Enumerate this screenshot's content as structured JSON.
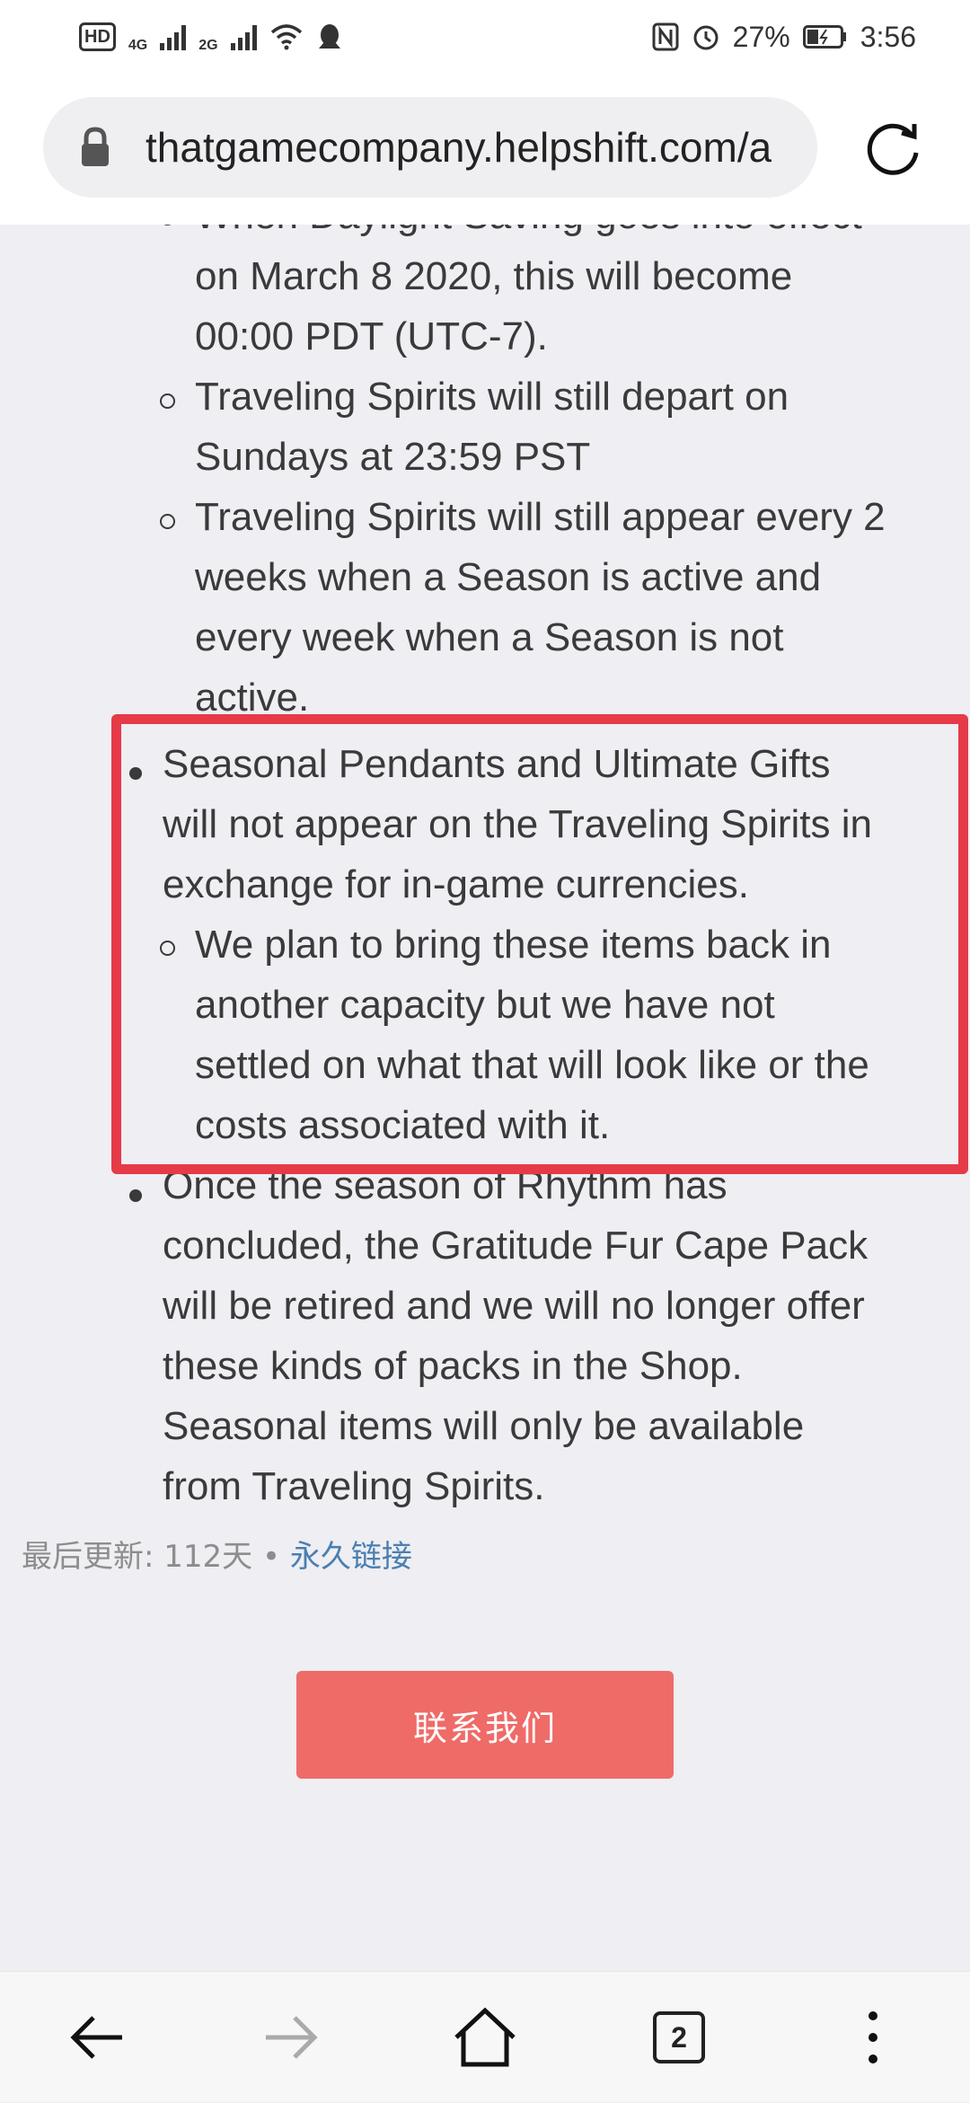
{
  "status_bar": {
    "hd": "HD",
    "net1": "4G",
    "net2": "2G",
    "battery": "27%",
    "time": "3:56",
    "icons": [
      "nfc-icon",
      "alarm-icon",
      "battery-icon",
      "wifi-icon",
      "notification-icon"
    ]
  },
  "browser": {
    "url": "thatgamecompany.helpshift.com/a",
    "tab_count": "2"
  },
  "article": {
    "lines": [
      "When Daylight Saving goes into effect",
      "on March 8 2020, this will become",
      "00:00 PDT (UTC-7).",
      "Traveling Spirits will still depart on",
      "Sundays at 23:59 PST",
      "Traveling Spirits will still appear every 2",
      "weeks when a Season is active and",
      "every week when a Season is not",
      "active.",
      "Seasonal Pendants and Ultimate Gifts",
      "will not appear on the Traveling Spirits in",
      "exchange for in-game currencies.",
      "We plan to bring these items back in",
      "another capacity but we have not",
      "settled on what that will look like or the",
      "costs associated with it.",
      "Once the season of Rhythm has",
      "concluded, the Gratitude Fur Cape Pack",
      "will be retired and we will no longer offer",
      "these kinds of packs in the Shop.",
      "Seasonal items will only be available",
      "from Traveling Spirits."
    ]
  },
  "footer": {
    "updated": "最后更新: 112天 • ",
    "permalink": "永久链接",
    "contact_button": "联系我们"
  },
  "colors": {
    "highlight": "#e63a48",
    "button": "#ef6b68",
    "link": "#4a7fb0"
  }
}
